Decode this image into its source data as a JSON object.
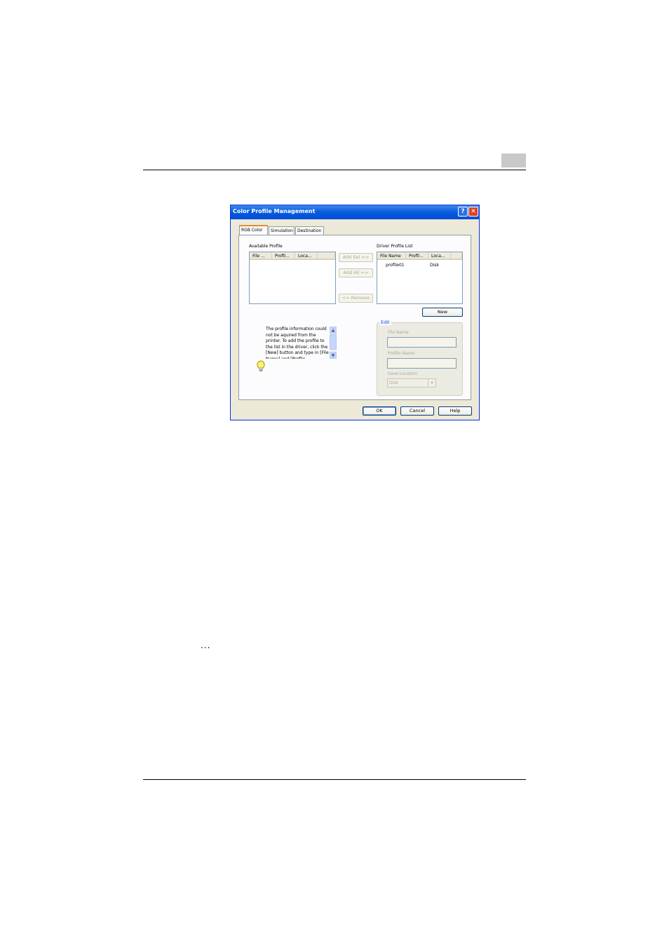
{
  "dialog": {
    "title": "Color Profile Management",
    "tabs": [
      "RGB Color",
      "Simulation",
      "Destination"
    ],
    "available_profile": {
      "label": "Available Profile",
      "columns": [
        "File ...",
        "Profil...",
        "Loca..."
      ]
    },
    "driver_profile_list": {
      "label": "Driver Profile List",
      "columns": [
        "File Name",
        "Profil...",
        "Loca..."
      ],
      "rows": [
        {
          "file_name": "profile01",
          "profile": "",
          "location": "Disk"
        }
      ]
    },
    "buttons": {
      "add_sel": "Add Sel =>",
      "add_all": "Add All =>",
      "remove": "<= Remove",
      "new": "New",
      "ok": "OK",
      "cancel": "Cancel",
      "help": "Help"
    },
    "info_text": "The profile information could not be aquired from the printer.  To add the profile to the list in the driver, click the [New] button and type in [File Name] and [Profile",
    "edit": {
      "title": "Edit",
      "file_name_label": "File Name",
      "profile_name_label": "Profile Name",
      "save_location_label": "Save Location",
      "save_location_value": "Disk"
    },
    "colors": {
      "titlebar": "#0054e3",
      "face": "#ece9d8",
      "tab_highlight": "#e68b2c"
    }
  },
  "page": {
    "ellipsis": "..."
  }
}
